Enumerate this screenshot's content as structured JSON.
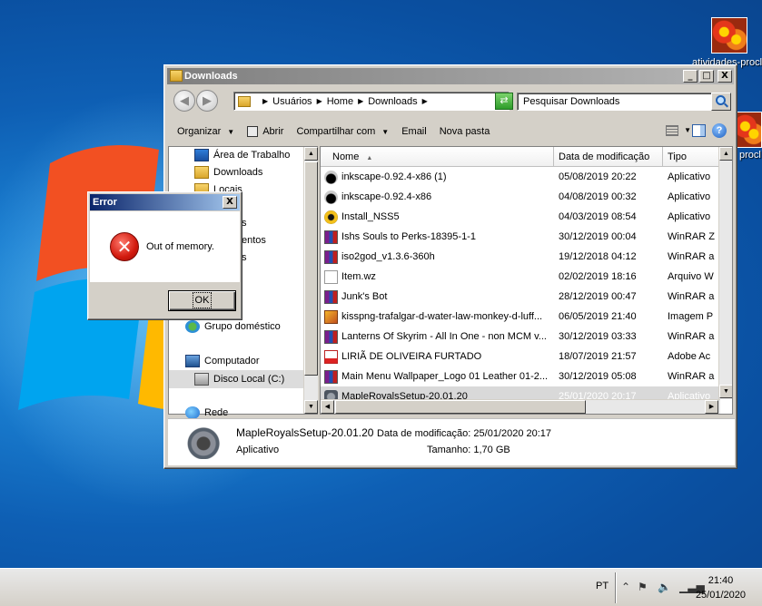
{
  "desktop": {
    "icons": [
      {
        "label": "atividades-procl"
      },
      {
        "label": "procl"
      }
    ]
  },
  "window": {
    "title": "Downloads",
    "controls": {
      "minimize": "_",
      "maximize": "□",
      "close": "X"
    },
    "breadcrumb": [
      "Usuários",
      "Home",
      "Downloads"
    ],
    "search_placeholder": "Pesquisar Downloads",
    "toolbar": {
      "organize": "Organizar",
      "open": "Abrir",
      "share": "Compartilhar com",
      "email": "Email",
      "new_folder": "Nova pasta"
    },
    "nav": {
      "desktop": "Área de Trabalho",
      "downloads": "Downloads",
      "locais": "Locais",
      "partial1": "s",
      "partial2": "entos",
      "partial3": "s",
      "homegroup": "Grupo doméstico",
      "computer": "Computador",
      "local_disk": "Disco Local (C:)",
      "network": "Rede"
    },
    "columns": {
      "name": "Nome",
      "modified": "Data de modificação",
      "type": "Tipo"
    },
    "files": [
      {
        "name": "inkscape-0.92.4-x86 (1)",
        "date": "05/08/2019 20:22",
        "type": "Aplicativo",
        "icon": "inkscape-icon"
      },
      {
        "name": "inkscape-0.92.4-x86",
        "date": "04/08/2019 00:32",
        "type": "Aplicativo",
        "icon": "inkscape-icon"
      },
      {
        "name": "Install_NSS5",
        "date": "04/03/2019 08:54",
        "type": "Aplicativo",
        "icon": "installer-icon"
      },
      {
        "name": "Ishs Souls to Perks-18395-1-1",
        "date": "30/12/2019 00:04",
        "type": "WinRAR Z",
        "icon": "winrar-icon"
      },
      {
        "name": "iso2god_v1.3.6-360h",
        "date": "19/12/2018 04:12",
        "type": "WinRAR a",
        "icon": "winrar-icon"
      },
      {
        "name": "Item.wz",
        "date": "02/02/2019 18:16",
        "type": "Arquivo W",
        "icon": "file-icon"
      },
      {
        "name": "Junk's Bot",
        "date": "28/12/2019 00:47",
        "type": "WinRAR a",
        "icon": "winrar-icon"
      },
      {
        "name": "kisspng-trafalgar-d-water-law-monkey-d-luff...",
        "date": "06/05/2019 21:40",
        "type": "Imagem P",
        "icon": "image-icon"
      },
      {
        "name": "Lanterns Of Skyrim - All In One - non MCM v...",
        "date": "30/12/2019 03:33",
        "type": "WinRAR a",
        "icon": "winrar-icon"
      },
      {
        "name": "LIRIÃ DE OLIVEIRA FURTADO",
        "date": "18/07/2019 21:57",
        "type": "Adobe Ac",
        "icon": "pdf-icon"
      },
      {
        "name": "Main Menu Wallpaper_Logo 01 Leather 01-2...",
        "date": "30/12/2019 05:08",
        "type": "WinRAR a",
        "icon": "winrar-icon"
      },
      {
        "name": "MapleRoyalsSetup-20.01.20",
        "date": "25/01/2020 20:17",
        "type": "Aplicativo",
        "icon": "setup-icon"
      }
    ],
    "details": {
      "name": "MapleRoyalsSetup-20.01.20",
      "type": "Aplicativo",
      "modified_label": "Data de modificação:",
      "modified": "25/01/2020 20:17",
      "size_label": "Tamanho:",
      "size": "1,70 GB"
    }
  },
  "dialog": {
    "title": "Error",
    "close": "X",
    "message": "Out of memory.",
    "ok": "OK"
  },
  "taskbar": {
    "language": "PT",
    "time": "21:40",
    "date": "25/01/2020"
  }
}
